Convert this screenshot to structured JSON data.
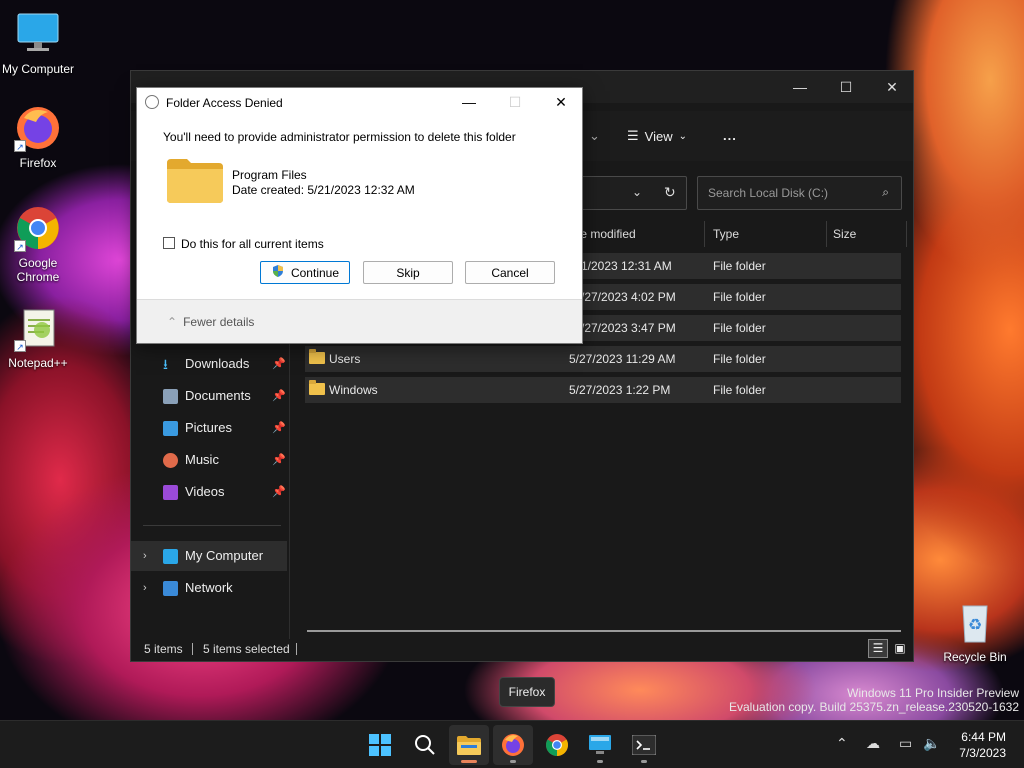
{
  "desktop": {
    "icons": [
      {
        "label": "My Computer"
      },
      {
        "label": "Firefox"
      },
      {
        "label": "Google\nChrome"
      },
      {
        "label": "Notepad++"
      },
      {
        "label": "Recycle Bin"
      }
    ],
    "watermark_line1": "Windows 11 Pro Insider Preview",
    "watermark_line2": "Evaluation copy. Build 25375.zn_release.230520-1632"
  },
  "explorer": {
    "toolbar": {
      "view_label": "View",
      "more_label": "..."
    },
    "search_placeholder": "Search Local Disk (C:)",
    "columns": {
      "modified": "te modified",
      "type": "Type",
      "size": "Size"
    },
    "rows": [
      {
        "name": "",
        "modified": "1/2023 12:31 AM",
        "type": "File folder"
      },
      {
        "name": "",
        "modified": "/27/2023 4:02 PM",
        "type": "File folder"
      },
      {
        "name": "",
        "modified": "/27/2023 3:47 PM",
        "type": "File folder"
      },
      {
        "name": "Users",
        "modified": "5/27/2023 11:29 AM",
        "type": "File folder"
      },
      {
        "name": "Windows",
        "modified": "5/27/2023 1:22 PM",
        "type": "File folder"
      }
    ],
    "nav": {
      "downloads": "Downloads",
      "documents": "Documents",
      "pictures": "Pictures",
      "music": "Music",
      "videos": "Videos",
      "my_computer": "My Computer",
      "network": "Network"
    },
    "status": {
      "items": "5 items",
      "selected": "5 items selected"
    }
  },
  "dialog": {
    "title": "Folder Access Denied",
    "message": "You'll need to provide administrator permission to delete this folder",
    "folder_name": "Program Files",
    "date_created": "Date created: 5/21/2023 12:32 AM",
    "checkbox_label": "Do this for all current items",
    "continue_label": "Continue",
    "skip_label": "Skip",
    "cancel_label": "Cancel",
    "fewer_details": "Fewer details"
  },
  "taskbar": {
    "tooltip": "Firefox",
    "time": "6:44 PM",
    "date": "7/3/2023"
  },
  "colors": {
    "accent": "#0078d4",
    "folder": "#f0c14b",
    "firefox_indicator": "#e8835a"
  }
}
